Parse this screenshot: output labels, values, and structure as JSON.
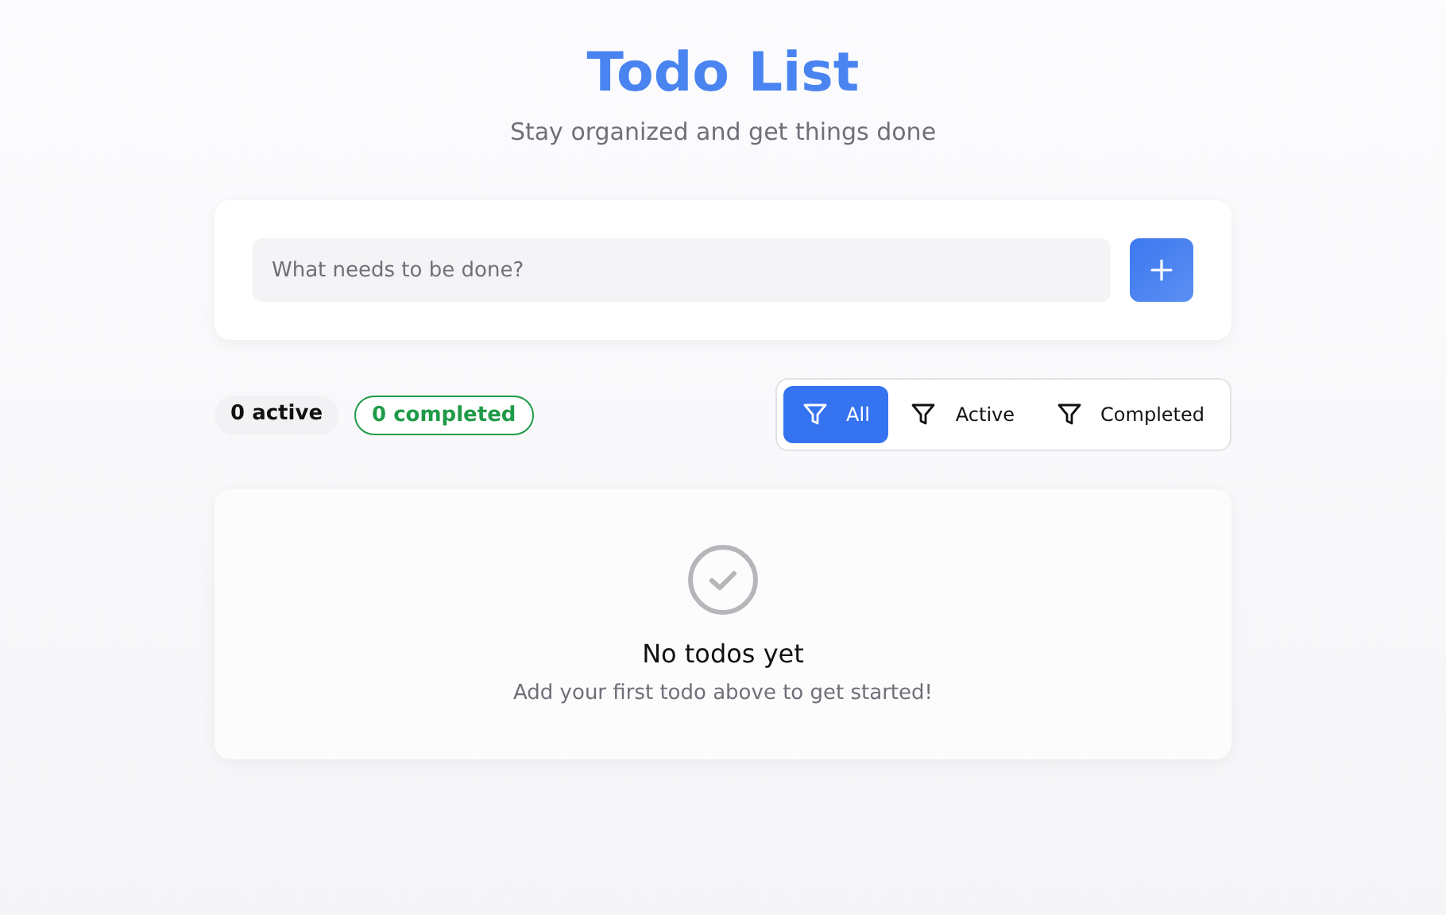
{
  "header": {
    "title": "Todo List",
    "subtitle": "Stay organized and get things done"
  },
  "new_todo": {
    "placeholder": "What needs to be done?"
  },
  "counts": [
    {
      "label": "0 active",
      "kind": "neutral"
    },
    {
      "label": "0 completed",
      "kind": "success"
    }
  ],
  "filters": [
    {
      "label": "All",
      "selected": true
    },
    {
      "label": "Active",
      "selected": false
    },
    {
      "label": "Completed",
      "selected": false
    }
  ],
  "empty_state": {
    "title": "No todos yet",
    "message": "Add your first todo above to get started!"
  }
}
